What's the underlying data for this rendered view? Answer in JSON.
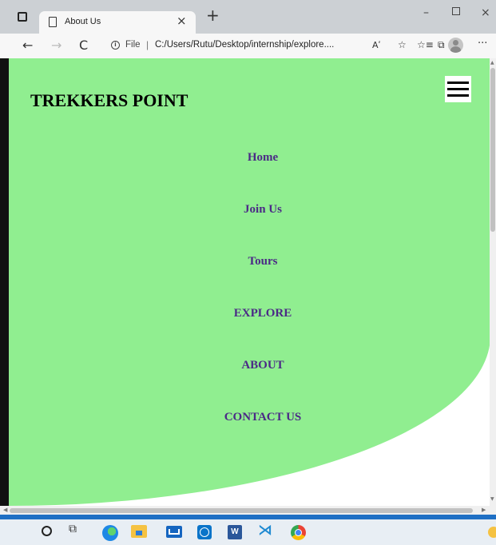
{
  "browser": {
    "tab_title": "About Us",
    "tab_close": "×",
    "new_tab": "+",
    "window_controls": {
      "minimize": "–",
      "close": "×"
    },
    "nav": {
      "back": "←",
      "forward": "→",
      "refresh": "C"
    },
    "address": {
      "info_icon": "i",
      "file_label": "File",
      "separator": "|",
      "url": "C:/Users/Rutu/Desktop/internship/explore...."
    },
    "toolbar_icons": {
      "read_aloud": "Aʹ",
      "favorites_add": "☆",
      "favorites": "☆≡",
      "collections": "⧉",
      "more": "···"
    }
  },
  "page": {
    "title": "TREKKERS POINT",
    "nav_links": {
      "home": "Home",
      "join": "Join Us",
      "tours": "Tours",
      "explore": "EXPLORE",
      "about": "ABOUT",
      "contact": "CONTACT US"
    },
    "colors": {
      "panel_background": "#90ee90",
      "nav_link": "#4b2a86",
      "title": "#000000"
    }
  },
  "scrollbars": {
    "up": "▲",
    "down": "▼",
    "left": "◀",
    "right": "▶"
  },
  "taskbar": {
    "task_view": "⧉",
    "word_letter": "W",
    "vscode_glyph": "⋊",
    "icons": [
      "search-icon",
      "task-view-icon",
      "edge-icon",
      "file-explorer-icon",
      "mail-icon",
      "dell-icon",
      "word-icon",
      "vscode-icon",
      "chrome-icon"
    ]
  }
}
